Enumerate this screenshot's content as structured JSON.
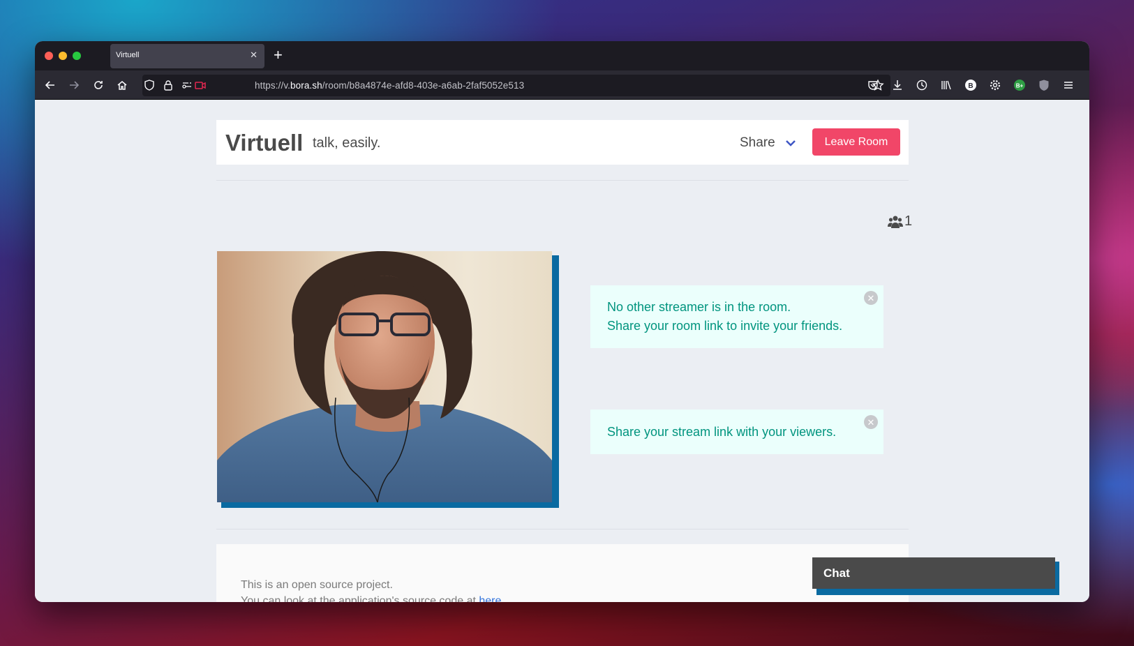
{
  "browser": {
    "tab_title": "Virtuell",
    "tab_close": "✕",
    "new_tab": "+",
    "url_prefix": "https://v.",
    "url_domain": "bora.sh",
    "url_path": "/room/b8a4874e-afd8-403e-a6ab-2faf5052e513"
  },
  "header": {
    "brand": "Virtuell",
    "tagline": "talk, easily.",
    "share_label": "Share",
    "leave_label": "Leave Room"
  },
  "room": {
    "viewer_count": "1"
  },
  "notices": [
    {
      "line1": "No other streamer is in the room.",
      "line2": "Share your room link to invite your friends."
    },
    {
      "line1": "Share your stream link with your viewers."
    }
  ],
  "footer": {
    "line1": "This is an open source project.",
    "line2_prefix": "You can look at the application's source code at ",
    "line2_link": "here."
  },
  "chat": {
    "label": "Chat"
  },
  "colors": {
    "leave_button": "#f14668",
    "notice_bg": "#ebfffc",
    "notice_text": "#00947e",
    "accent_shadow": "#0a6aa1",
    "share_chevron": "#3e56c4"
  }
}
